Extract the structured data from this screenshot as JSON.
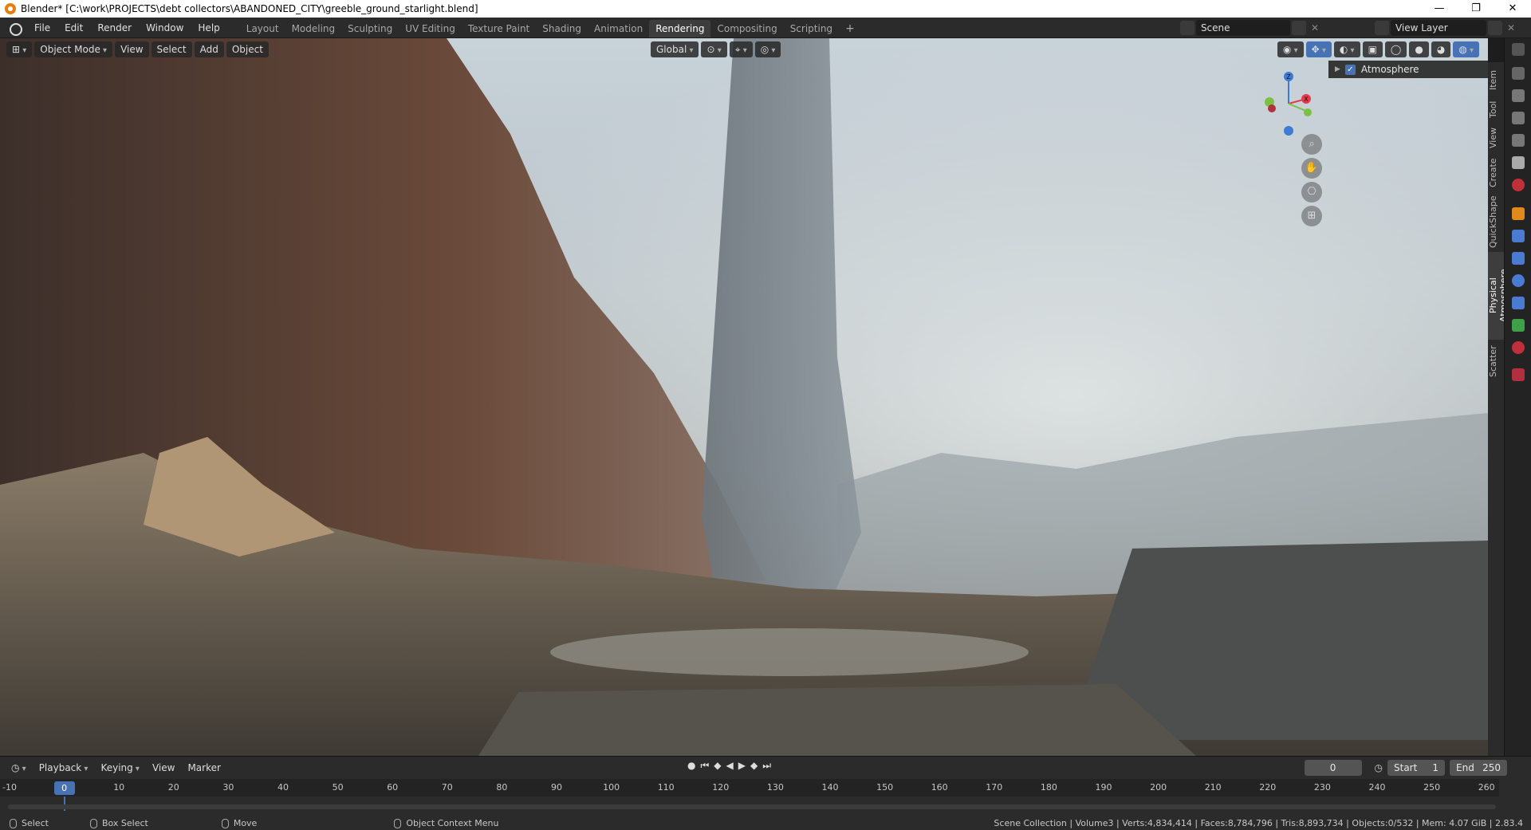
{
  "window": {
    "title": "Blender* [C:\\work\\PROJECTS\\debt collectors\\ABANDONED_CITY\\greeble_ground_starlight.blend]",
    "controls": [
      "—",
      "❐",
      "✕"
    ]
  },
  "menu": [
    "File",
    "Edit",
    "Render",
    "Window",
    "Help"
  ],
  "workspaces": {
    "tabs": [
      "Layout",
      "Modeling",
      "Sculpting",
      "UV Editing",
      "Texture Paint",
      "Shading",
      "Animation",
      "Rendering",
      "Compositing",
      "Scripting"
    ],
    "active": "Rendering",
    "add": "+"
  },
  "scene": {
    "name": "Scene"
  },
  "view_layer": {
    "name": "View Layer"
  },
  "viewport_header": {
    "mode": "Object Mode",
    "menus": [
      "View",
      "Select",
      "Add",
      "Object"
    ],
    "orientation": "Global"
  },
  "outliner": {
    "item": "Atmosphere",
    "checked": true
  },
  "sidebar_tabs": [
    "Item",
    "Tool",
    "View",
    "Create",
    "QuickShape",
    "Physical Atmosphere",
    "Scatter"
  ],
  "sidebar_active": "Physical Atmosphere",
  "gizmo": {
    "x": "X",
    "y": "Y",
    "z": "Z"
  },
  "timeline": {
    "menus": [
      "Playback",
      "Keying",
      "View",
      "Marker"
    ],
    "current_frame": "0",
    "start_label": "Start",
    "start": "1",
    "end_label": "End",
    "end": "250",
    "ticks": [
      "-10",
      "0",
      "10",
      "20",
      "30",
      "40",
      "50",
      "60",
      "70",
      "80",
      "90",
      "100",
      "110",
      "120",
      "130",
      "140",
      "150",
      "160",
      "170",
      "180",
      "190",
      "200",
      "210",
      "220",
      "230",
      "240",
      "250",
      "260"
    ]
  },
  "status": {
    "select": "Select",
    "box_select": "Box Select",
    "move": "Move",
    "context_menu": "Object Context Menu",
    "stats": "Scene Collection | Volume3 | Verts:4,834,414 | Faces:8,784,796 | Tris:8,893,734 | Objects:0/532 | Mem: 4.07 GiB | 2.83.4"
  },
  "colors": {
    "accent": "#4772b3",
    "header": "#2b2b2b",
    "x_axis": "#e53a4a",
    "y_axis": "#7bc043",
    "z_axis": "#3d7bd4"
  }
}
